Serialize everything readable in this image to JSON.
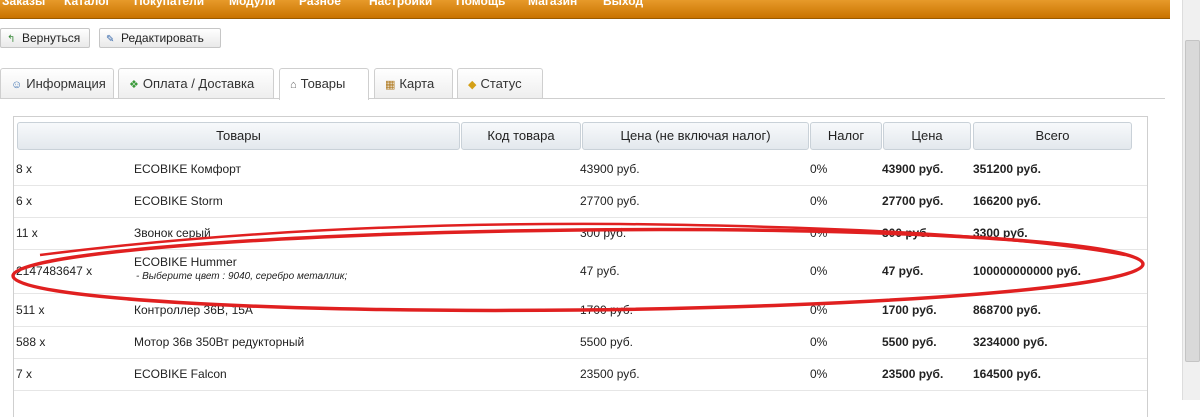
{
  "nav": [
    "Заказы",
    "Каталог",
    "Покупатели",
    "Модули",
    "Разное",
    "Настройки",
    "Помощь",
    "Магазин",
    "Выход"
  ],
  "buttons": {
    "back": "Вернуться",
    "edit": "Редактировать"
  },
  "tabs": [
    "Информация",
    "Оплата / Доставка",
    "Товары",
    "Карта",
    "Статус"
  ],
  "active_tab": "Товары",
  "table": {
    "headers": [
      "Товары",
      "Код товара",
      "Цена (не включая налог)",
      "Налог",
      "Цена",
      "Всего"
    ],
    "rows": [
      {
        "qty": "8 x",
        "name": "ECOBIKE Комфорт",
        "option": "",
        "price_ex": "43900 руб.",
        "tax": "0%",
        "price": "43900 руб.",
        "total": "351200 руб."
      },
      {
        "qty": "6 x",
        "name": "ECOBIKE Storm",
        "option": "",
        "price_ex": "27700 руб.",
        "tax": "0%",
        "price": "27700 руб.",
        "total": "166200 руб."
      },
      {
        "qty": "11 x",
        "name": "Звонок серый",
        "option": "",
        "price_ex": "300 руб.",
        "tax": "0%",
        "price": "300 руб.",
        "total": "3300 руб."
      },
      {
        "qty": "2147483647 x",
        "name": "ECOBIKE Hummer",
        "option": "- Выберите цвет : 9040, серебро металлик;",
        "price_ex": "47 руб.",
        "tax": "0%",
        "price": "47 руб.",
        "total": "100000000000 руб."
      },
      {
        "qty": "511 x",
        "name": "Контроллер 36В, 15А",
        "option": "",
        "price_ex": "1700 руб.",
        "tax": "0%",
        "price": "1700 руб.",
        "total": "868700 руб."
      },
      {
        "qty": "588 x",
        "name": "Мотор 36в 350Вт редукторный",
        "option": "",
        "price_ex": "5500 руб.",
        "tax": "0%",
        "price": "5500 руб.",
        "total": "3234000 руб."
      },
      {
        "qty": "7 x",
        "name": "ECOBIKE Falcon",
        "option": "",
        "price_ex": "23500 руб.",
        "tax": "0%",
        "price": "23500 руб.",
        "total": "164500 руб."
      }
    ]
  },
  "colors": {
    "nav_bg": "#d98610",
    "annotation": "#e02020"
  }
}
